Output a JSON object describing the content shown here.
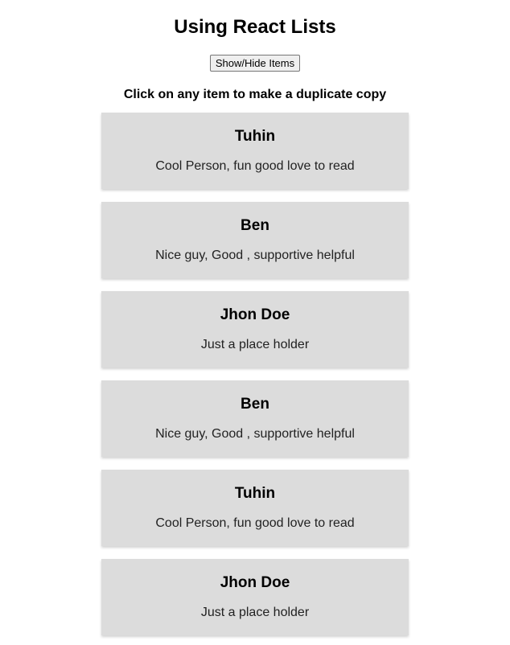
{
  "page": {
    "title": "Using React Lists",
    "toggle_label": "Show/Hide Items",
    "instructions": "Click on any item to make a duplicate copy"
  },
  "items": [
    {
      "name": "Tuhin",
      "description": "Cool Person, fun good love to read"
    },
    {
      "name": "Ben",
      "description": "Nice guy, Good , supportive helpful"
    },
    {
      "name": "Jhon Doe",
      "description": "Just a place holder"
    },
    {
      "name": "Ben",
      "description": "Nice guy, Good , supportive helpful"
    },
    {
      "name": "Tuhin",
      "description": "Cool Person, fun good love to read"
    },
    {
      "name": "Jhon Doe",
      "description": "Just a place holder"
    }
  ]
}
